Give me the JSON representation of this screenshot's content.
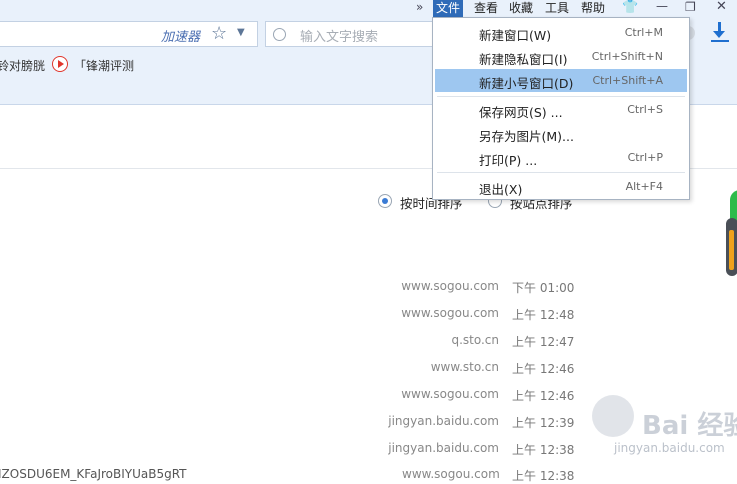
{
  "toolbar": {
    "accelerator_label": "加速器",
    "search_placeholder": "输入文字搜索"
  },
  "bookmarks": [
    {
      "label": "铃对膀胱"
    },
    {
      "label": "「锋潮评测"
    }
  ],
  "menubar": {
    "chevron": "»",
    "items": [
      "文件",
      "查看",
      "收藏",
      "工具",
      "帮助"
    ],
    "active_index": 0
  },
  "file_menu": {
    "items": [
      {
        "label": "新建窗口(W)",
        "shortcut": "Ctrl+M"
      },
      {
        "label": "新建隐私窗口(I)",
        "shortcut": "Ctrl+Shift+N"
      },
      {
        "label": "新建小号窗口(D)",
        "shortcut": "Ctrl+Shift+A"
      },
      {
        "label": "保存网页(S) ...",
        "shortcut": "Ctrl+S"
      },
      {
        "label": "另存为图片(M)...",
        "shortcut": ""
      },
      {
        "label": "打印(P) ...",
        "shortcut": "Ctrl+P"
      },
      {
        "label": "退出(X)",
        "shortcut": "Alt+F4"
      }
    ],
    "highlighted_index": 2
  },
  "sort": {
    "by_time": "按时间排序",
    "by_site": "按站点排序",
    "selected": "by_time"
  },
  "history": [
    {
      "domain": "www.sogou.com",
      "time": "下午 01:00"
    },
    {
      "domain": "www.sogou.com",
      "time": "上午 12:48"
    },
    {
      "domain": "q.sto.cn",
      "time": "上午 12:47"
    },
    {
      "domain": "www.sto.cn",
      "time": "上午 12:46"
    },
    {
      "domain": "www.sogou.com",
      "time": "上午 12:46"
    },
    {
      "domain": "jingyan.baidu.com",
      "time": "上午 12:39"
    },
    {
      "domain": "jingyan.baidu.com",
      "time": "上午 12:38"
    }
  ],
  "partial_row": {
    "text": "IZOSDU6EM_KFaJroBIYUaB5gRT",
    "domain": "www.sogou.com",
    "time": "上午 12:38"
  },
  "watermark": {
    "text": "Bai 经验",
    "sub": "jingyan.baidu.com"
  },
  "colors": {
    "menu_active": "#2f6bb8",
    "menu_highlight": "#9ec7f0",
    "accent": "#1f6fcf"
  }
}
